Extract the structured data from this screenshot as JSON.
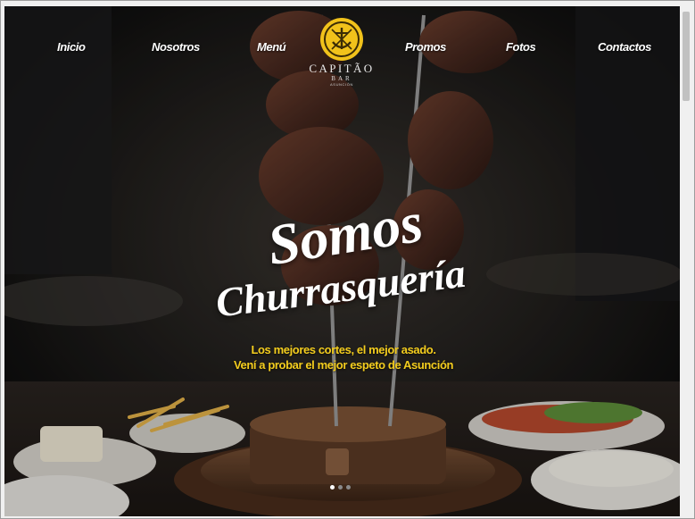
{
  "nav": {
    "items": [
      {
        "label": "Inicio"
      },
      {
        "label": "Nosotros"
      },
      {
        "label": "Menú"
      },
      {
        "label": "Promos"
      },
      {
        "label": "Fotos"
      },
      {
        "label": "Contactos"
      }
    ]
  },
  "logo": {
    "name": "CAPITÃO",
    "sub": "BAR",
    "city": "ASUNCIÓN"
  },
  "hero": {
    "headline_1": "Somos",
    "headline_2": "Churrasquería",
    "tagline_1": "Los mejores cortes, el mejor asado.",
    "tagline_2": "Vení a probar el mejor espeto de Asunción",
    "slide_count": 3,
    "active_slide": 1
  },
  "colors": {
    "accent": "#f4cd1e",
    "text": "#ffffff",
    "background": "#121212"
  }
}
